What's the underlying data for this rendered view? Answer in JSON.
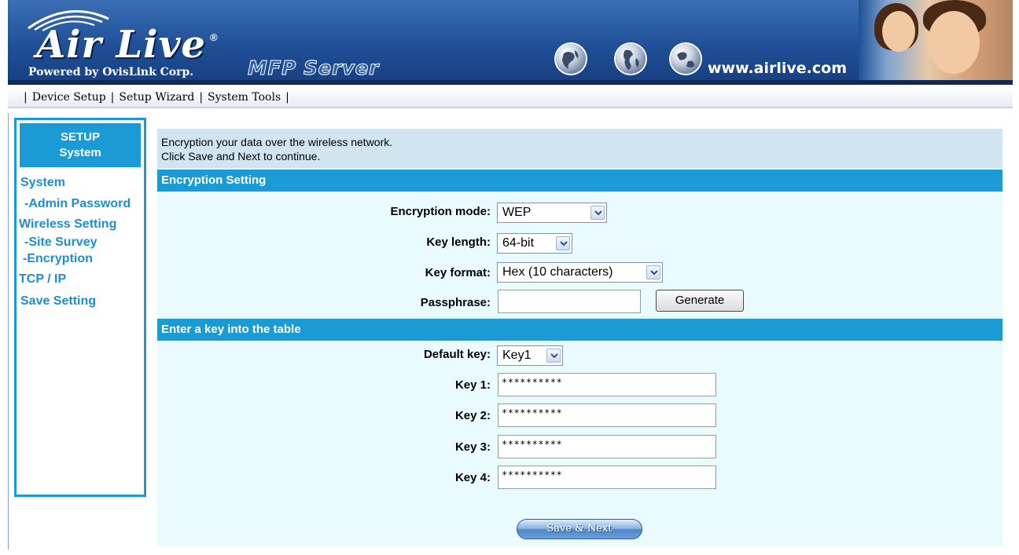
{
  "banner": {
    "logo_text": "Air Live",
    "logo_reg": "®",
    "logo_sub": "Powered by OvisLink Corp.",
    "product": "MFP Server",
    "url": "www.airlive.com"
  },
  "topnav": {
    "items": [
      "Device Setup",
      "Setup Wizard",
      "System Tools"
    ]
  },
  "sidebar": {
    "header_line1": "SETUP",
    "header_line2": "System",
    "links": [
      "System",
      "-Admin Password",
      "Wireless Setting",
      "-Site Survey",
      "-Encryption",
      "TCP / IP",
      "Save Setting"
    ]
  },
  "main": {
    "intro_line1": "Encryption your data over the wireless network.",
    "intro_line2": "Click Save and Next to continue.",
    "section1_title": "Encryption Setting",
    "encryption_mode_label": "Encryption mode:",
    "encryption_mode_value": "WEP",
    "key_length_label": "Key length:",
    "key_length_value": "64-bit",
    "key_format_label": "Key format:",
    "key_format_value": "Hex (10 characters)",
    "passphrase_label": "Passphrase:",
    "passphrase_value": "",
    "generate_label": "Generate",
    "section2_title": "Enter a key into the table",
    "default_key_label": "Default key:",
    "default_key_value": "Key1",
    "keys": [
      {
        "label": "Key 1:",
        "value": "**********"
      },
      {
        "label": "Key 2:",
        "value": "**********"
      },
      {
        "label": "Key 3:",
        "value": "**********"
      },
      {
        "label": "Key 4:",
        "value": "**********"
      }
    ],
    "save_next_label": "Save & Next"
  },
  "colors": {
    "accent": "#1a9bd6",
    "banner": "#1f4f96",
    "content_bg": "#e9fbff",
    "intro_bg": "#d1e5f1"
  }
}
